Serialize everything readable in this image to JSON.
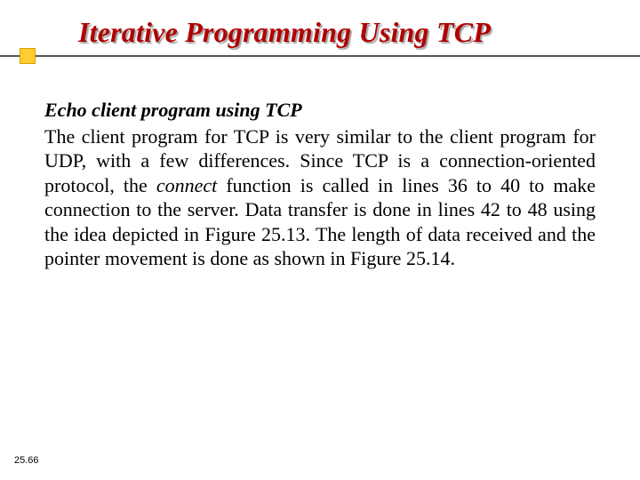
{
  "slide": {
    "title": "Iterative Programming Using TCP",
    "subheading": "Echo client program using TCP",
    "body_pre": "The client program for TCP is very similar to the client program for UDP, with a few differences. Since TCP is a connection-oriented protocol, the ",
    "body_em": "connect",
    "body_post": " function is called in lines 36 to 40 to make connection to the server. Data transfer is done in lines 42 to 48 using the idea depicted in Figure 25.13. The length of data received and the pointer movement is done as shown in Figure 25.14.",
    "page_number": "25.66"
  }
}
